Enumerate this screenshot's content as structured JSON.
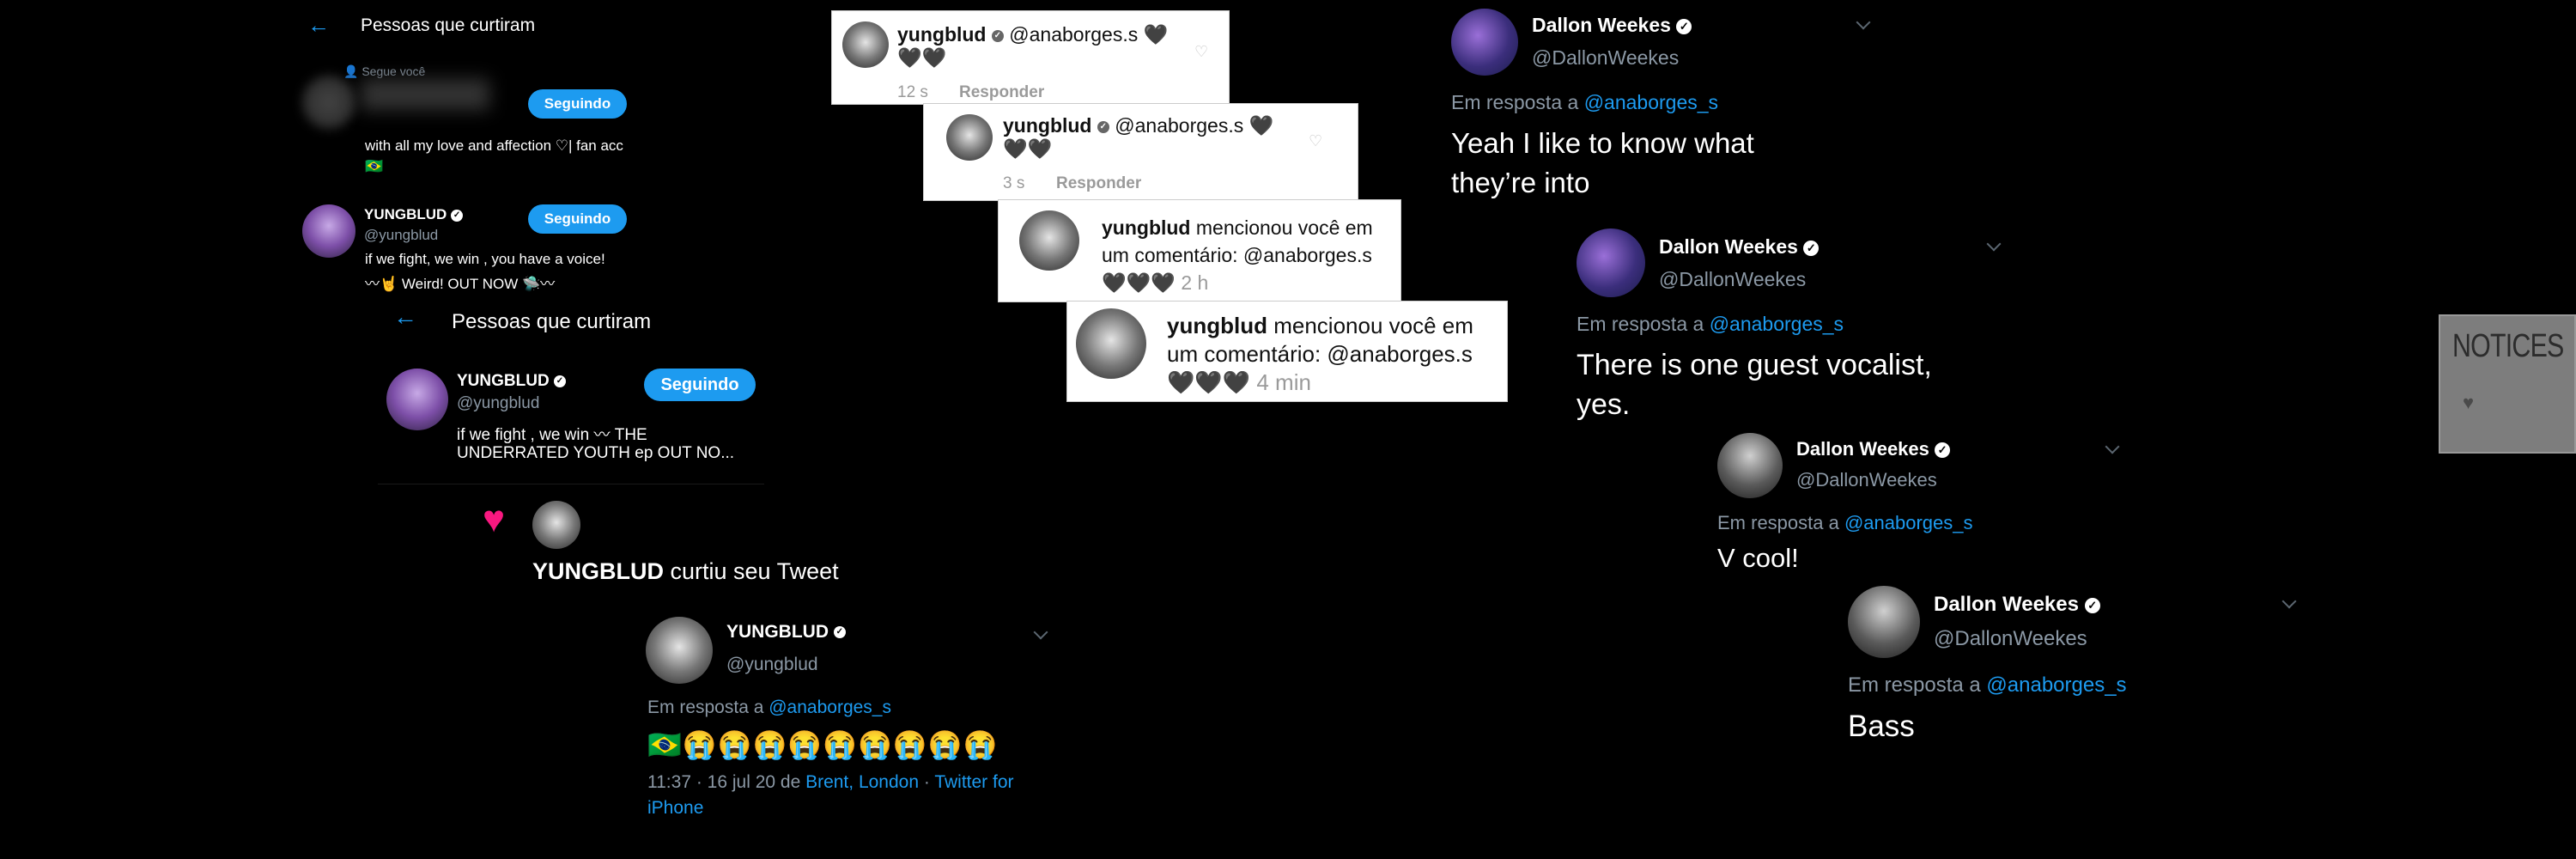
{
  "likes_screen_1": {
    "back_icon": "arrow-left-icon",
    "title": "Pessoas que curtiram",
    "follows_you": "Segue você",
    "user1": {
      "bio": "with all my love and affection ♡| fan acc 🇧🇷",
      "button": "Seguindo"
    },
    "user2": {
      "name": "YUNGBLUD",
      "handle": "@yungblud",
      "bio_line1": "if we fight, we win , you have a voice!",
      "bio_line2": "〰🤘 Weird! OUT NOW 🛸〰",
      "button": "Seguindo"
    }
  },
  "likes_screen_2": {
    "title": "Pessoas que curtiram",
    "user": {
      "name": "YUNGBLUD",
      "handle": "@yungblud",
      "bio_line1": "if we fight , we win 〰 THE",
      "bio_line2": "UNDERRATED YOUTH ep OUT NO...",
      "button": "Seguindo"
    }
  },
  "like_notification": {
    "text_name": "YUNGBLUD",
    "text_rest": " curtiu seu Tweet"
  },
  "yungblud_reply": {
    "name": "YUNGBLUD",
    "handle": "@yungblud",
    "reply_prefix": "Em resposta a ",
    "reply_to": "@anaborges_s",
    "body": "🇧🇷😭😭😭😭😭😭😭😭😭",
    "meta_time": "11:37 · 16 jul 20 de ",
    "meta_location": "Brent, London",
    "meta_sep": " · ",
    "meta_client": "Twitter for iPhone"
  },
  "ig_comments": [
    {
      "user": "yungblud",
      "text": " @anaborges.s 🖤",
      "text2": "🖤🖤",
      "time": "12 s",
      "reply": "Responder"
    },
    {
      "user": "yungblud",
      "text": " @anaborges.s 🖤",
      "text2": "🖤🖤",
      "time": "3 s",
      "reply": "Responder"
    }
  ],
  "ig_mentions": [
    {
      "user": "yungblud",
      "text1": " mencionou você em",
      "text2": "um comentário: @anaborges.s",
      "hearts": "🖤🖤🖤",
      "time": "2 h"
    },
    {
      "user": "yungblud",
      "text1": " mencionou você em",
      "text2": "um comentário: @anaborges.s",
      "hearts": "🖤🖤🖤",
      "time": "4 min"
    }
  ],
  "dallon_tweets": [
    {
      "name": "Dallon Weekes",
      "handle": "@DallonWeekes",
      "reply_prefix": "Em resposta a ",
      "reply_to": "@anaborges_s",
      "body1": "Yeah I like to know what",
      "body2": "they’re into"
    },
    {
      "name": "Dallon Weekes",
      "handle": "@DallonWeekes",
      "reply_prefix": "Em resposta a ",
      "reply_to": "@anaborges_s",
      "body1": "There is one guest vocalist,",
      "body2": "yes."
    },
    {
      "name": "Dallon Weekes",
      "handle": "@DallonWeekes",
      "reply_prefix": "Em resposta a ",
      "reply_to": "@anaborges_s",
      "body1": "V cool!"
    },
    {
      "name": "Dallon Weekes",
      "handle": "@DallonWeekes",
      "reply_prefix": "Em resposta a ",
      "reply_to": "@anaborges_s",
      "body1": "Bass"
    }
  ],
  "notices": {
    "label": "NOTICES",
    "heart": "♥"
  },
  "colors": {
    "link": "#1d9bf0",
    "background": "#000000",
    "muted": "#8b98a5",
    "heart": "#f91880"
  }
}
